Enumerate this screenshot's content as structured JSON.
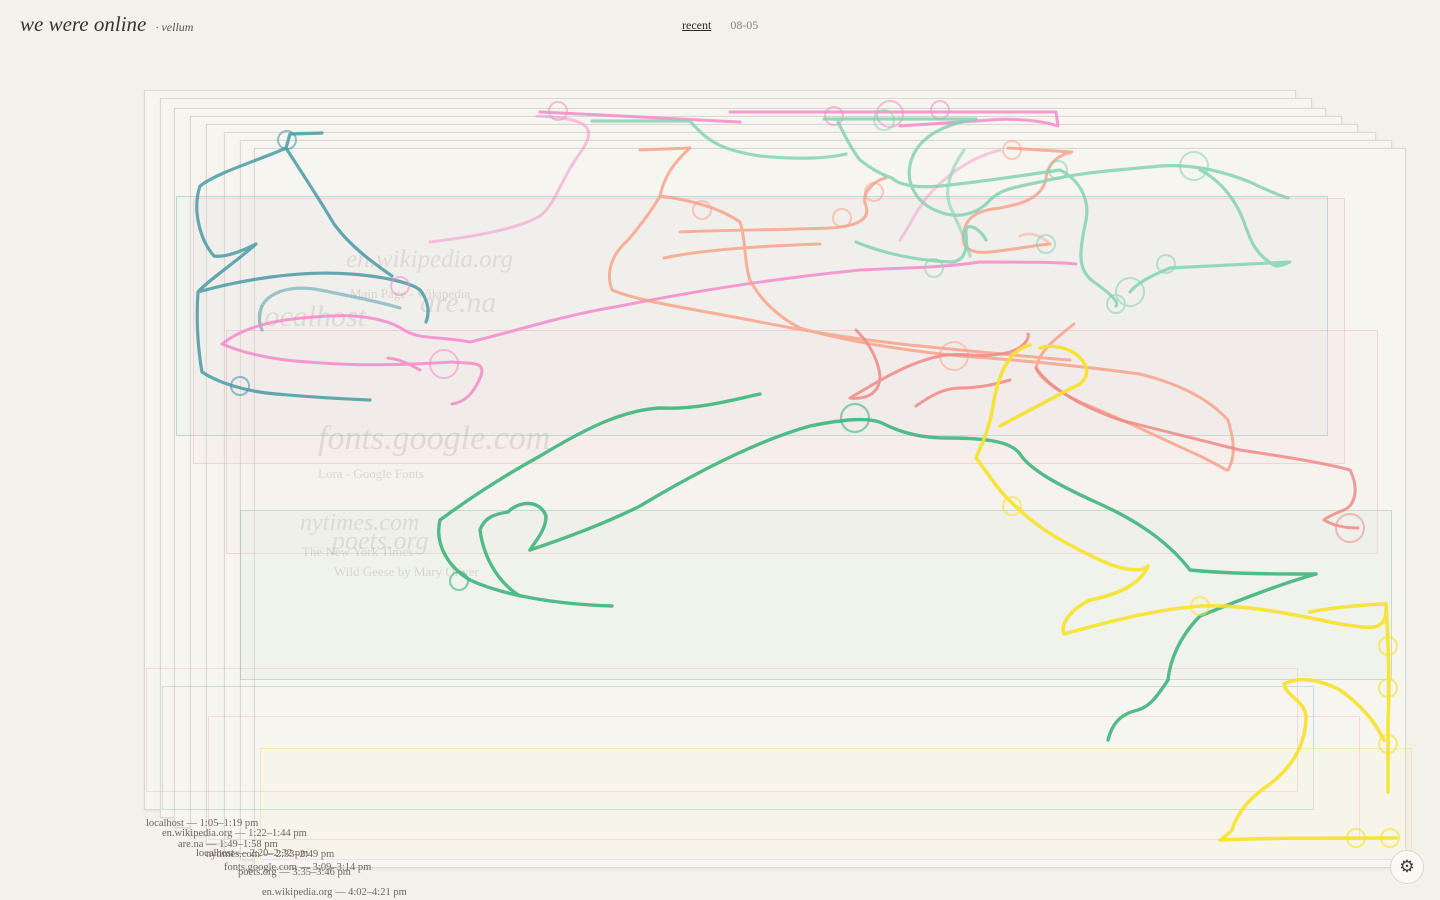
{
  "app": {
    "title": "we were online",
    "subtitle": "· vellum"
  },
  "nav": {
    "recent": "recent",
    "date": "08-05"
  },
  "ghost_titles": [
    "en.wikipedia.org",
    "Main Page - Wikipedia",
    "are.na",
    "localhost",
    "fonts.google.com",
    "Lora - Google Fonts",
    "nytimes.com",
    "The New York Times",
    "poets.org",
    "Wild Geese by Mary Oliver"
  ],
  "sessions": [
    "localhost — 1:05–1:19 pm",
    "en.wikipedia.org — 1:22–1:44 pm",
    "are.na — 1:49–1:58 pm",
    "localhost — 2:20–2:32 pm",
    "nytimes.com — 2:33–2:49 pm",
    "fonts.google.com — 3:09–3:14 pm",
    "poets.org — 3:35–3:46 pm",
    "en.wikipedia.org — 4:02–4:21 pm"
  ],
  "colors": {
    "background": "#f4f0ea",
    "teal": "#4a9aa6",
    "pink": "#f58bcb",
    "salmon": "#f7a48a",
    "red": "#f08a86",
    "mint": "#84d3b4",
    "green": "#3fb67c",
    "yellow": "#f8e22b"
  },
  "settings_icon": "gear-icon"
}
